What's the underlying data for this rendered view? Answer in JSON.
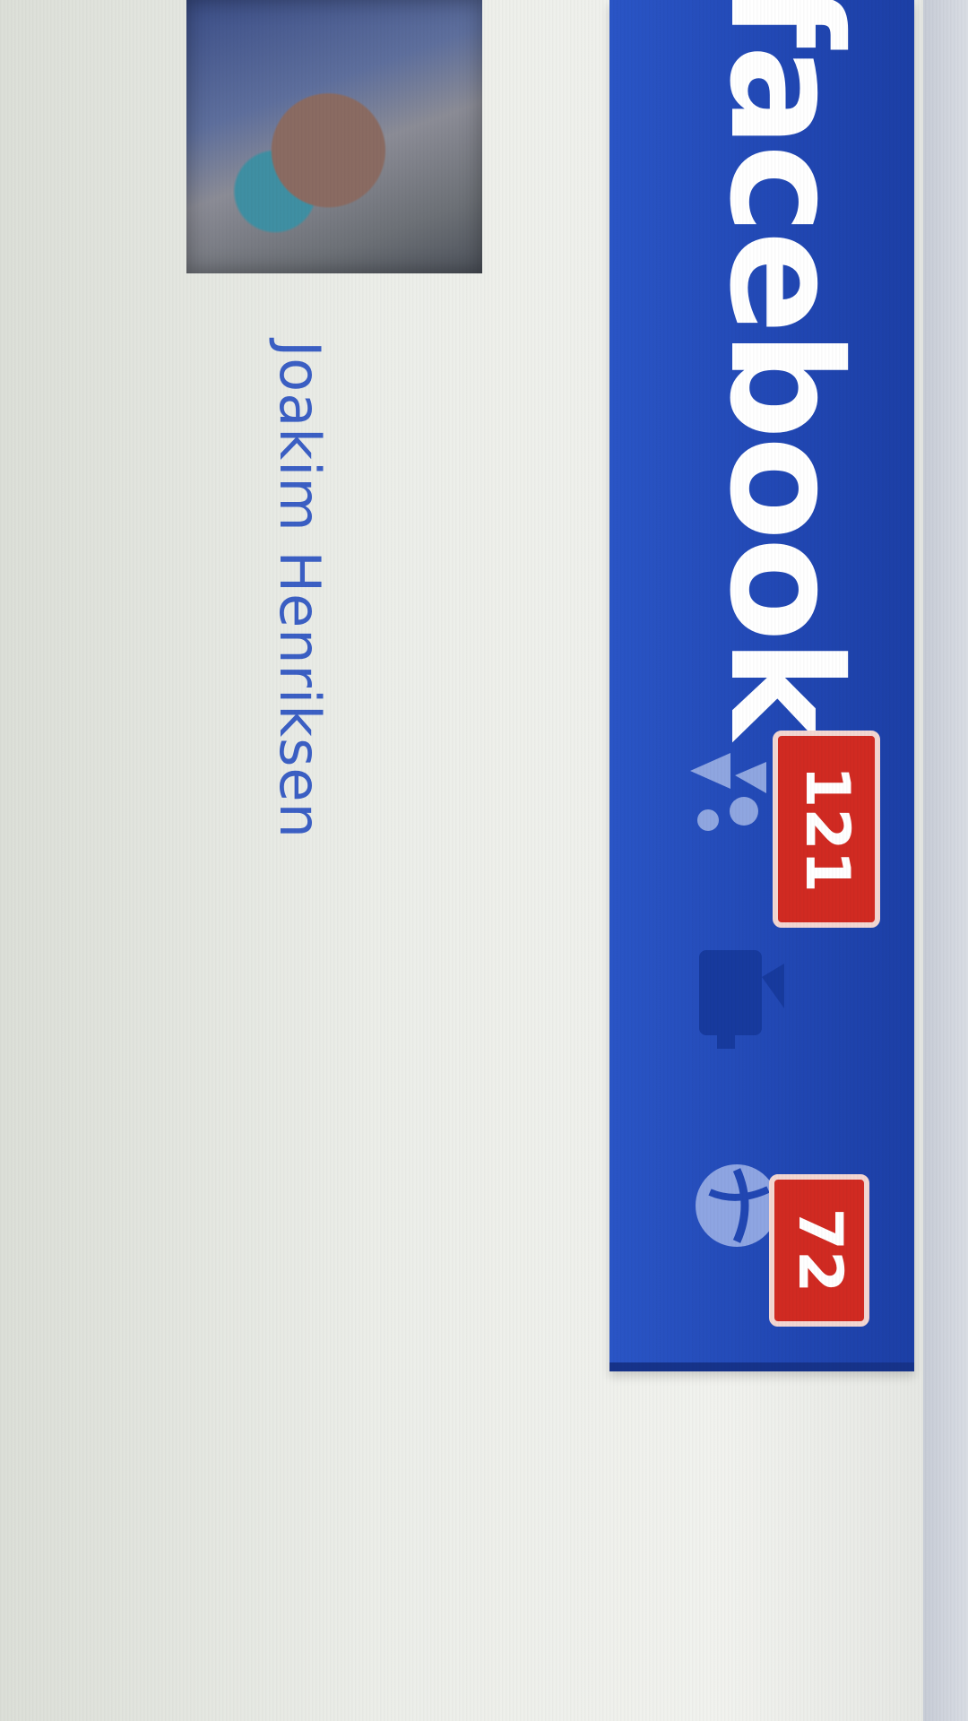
{
  "header": {
    "logo_text": "facebook",
    "friend_requests": {
      "icon": "friends-icon",
      "count": "121"
    },
    "messages": {
      "icon": "messages-icon"
    },
    "notifications": {
      "icon": "globe-icon",
      "count": "72"
    }
  },
  "profile": {
    "avatar": "profile-photo",
    "name": "Joakim Henriksen"
  },
  "colors": {
    "brand_blue": "#2147b3",
    "badge_red": "#d12a22",
    "link_blue": "#3b5fc4"
  }
}
